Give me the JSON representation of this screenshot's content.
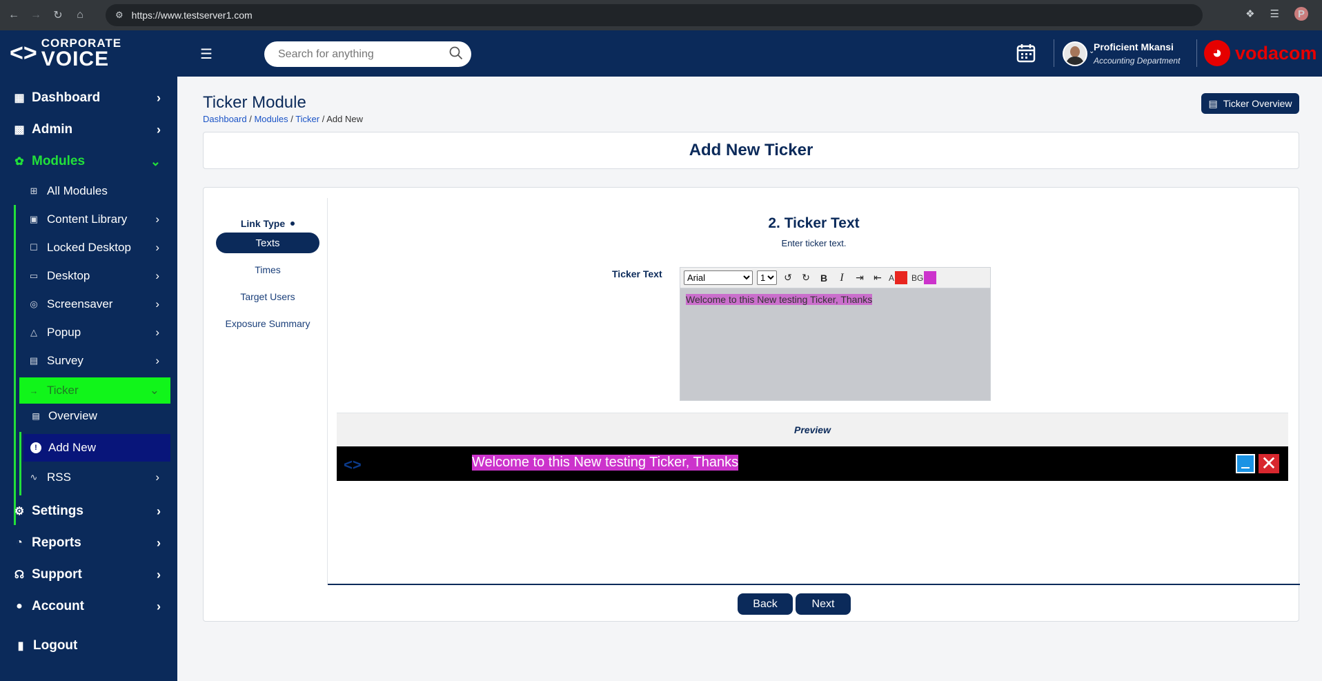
{
  "browser": {
    "url": "https://www.testserver1.com",
    "profile_initial": "P"
  },
  "brand": {
    "logo_line1": "CORPORATE",
    "logo_line2": "VOICE",
    "vodafone_text": "vodacom"
  },
  "search": {
    "placeholder": "Search for anything"
  },
  "user": {
    "name": "Proficient Mkansi",
    "department": "Accounting Department"
  },
  "sidebar": {
    "main": [
      {
        "label": "Dashboard",
        "icon": "grid-icon"
      },
      {
        "label": "Admin",
        "icon": "building-icon"
      },
      {
        "label": "Modules",
        "icon": "modules-icon"
      },
      {
        "label": "Settings",
        "icon": "gear-icon"
      },
      {
        "label": "Reports",
        "icon": "pie-chart-icon"
      },
      {
        "label": "Support",
        "icon": "headset-icon"
      },
      {
        "label": "Account",
        "icon": "user-icon"
      },
      {
        "label": "Logout",
        "icon": "logout-icon"
      }
    ],
    "modules_sub": [
      {
        "label": "All Modules"
      },
      {
        "label": "Content Library"
      },
      {
        "label": "Locked Desktop"
      },
      {
        "label": "Desktop"
      },
      {
        "label": "Screensaver"
      },
      {
        "label": "Popup"
      },
      {
        "label": "Survey"
      },
      {
        "label": "Ticker"
      },
      {
        "label": "RSS"
      }
    ],
    "ticker_sub": [
      {
        "label": "Overview"
      },
      {
        "label": "Add New"
      }
    ]
  },
  "page": {
    "title": "Ticker Module",
    "breadcrumb": [
      "Dashboard",
      "Modules",
      "Ticker",
      "Add New"
    ],
    "overview_button": "Ticker Overview",
    "card_title": "Add New Ticker"
  },
  "steps": [
    {
      "label": "Link Type",
      "state": "done"
    },
    {
      "label": "Texts",
      "state": "current"
    },
    {
      "label": "Times",
      "state": "pending"
    },
    {
      "label": "Target Users",
      "state": "pending"
    },
    {
      "label": "Exposure Summary",
      "state": "pending"
    }
  ],
  "form": {
    "heading": "2. Ticker Text",
    "subheading": "Enter ticker text.",
    "field_label": "Ticker Text",
    "font_value": "Arial",
    "size_value": "1",
    "text_color_label": "A",
    "bg_color_label": "BG",
    "text_color": "#e8251f",
    "bg_color": "#cc33cc",
    "editor_text": "Welcome to this New testing Ticker, Thanks"
  },
  "preview": {
    "label": "Preview",
    "ticker_text": "Welcome to this New testing Ticker, Thanks",
    "ticker_bg": "#cc33cc"
  },
  "buttons": {
    "back": "Back",
    "next": "Next"
  }
}
